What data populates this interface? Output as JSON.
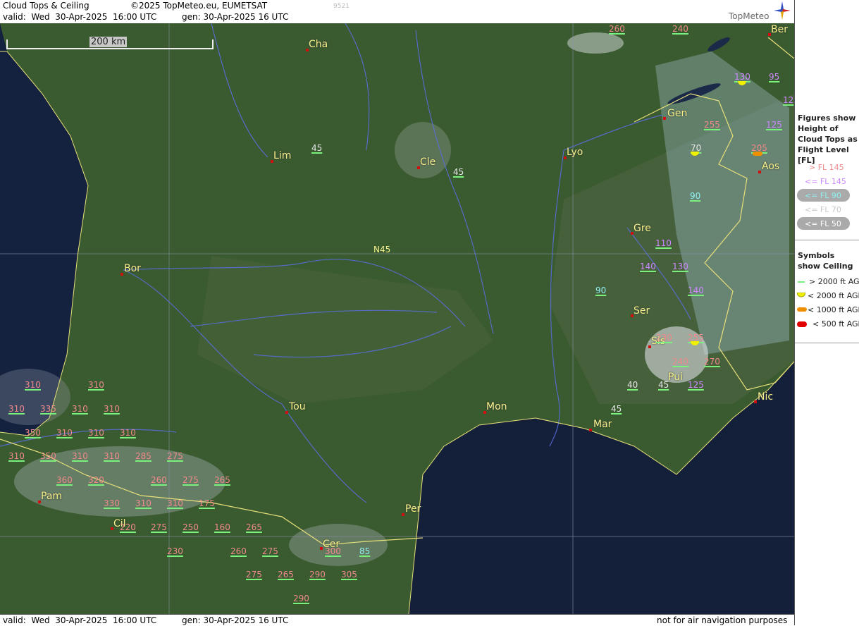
{
  "header": {
    "title": "Cloud Tops & Ceiling",
    "copyright": "©2025 TopMeteo.eu, EUMETSAT",
    "valid": "valid:  Wed  30-Apr-2025  16:00 UTC",
    "gen": "gen: 30-Apr-2025 16 UTC",
    "code": "9521",
    "logo": "TopMeteo"
  },
  "footer": {
    "valid": "valid:  Wed  30-Apr-2025  16:00 UTC",
    "gen": "gen: 30-Apr-2025 16 UTC",
    "disclaimer": "not for air navigation purposes"
  },
  "scale_label": "200 km",
  "graticule_label": "N45",
  "legend": {
    "figures_title": "Figures show Height of Cloud Tops as Flight Level  [FL]",
    "fl_items": [
      "> FL 145",
      "<= FL 145",
      "<= FL 90",
      "<= FL 70",
      "<= FL 50"
    ],
    "fl_colors": [
      "#f08a8a",
      "#cc88ff",
      "#8ff0f0",
      "#c8c8c8",
      "#e8e8e8"
    ],
    "symbols_title": "Symbols show Ceiling",
    "ceil_items": [
      "> 2000 ft AGL",
      "< 2000 ft AGL",
      "< 1000 ft AGL",
      "< 500 ft AGL"
    ],
    "ceil_colors": [
      "#7cf07c",
      "#f0f000",
      "#f09000",
      "#e00000"
    ]
  },
  "cities": [
    "Cha",
    "Lim",
    "Cle",
    "Lyo",
    "Gen",
    "Ber",
    "Aos",
    "Gre",
    "Bor",
    "Ser",
    "Sis",
    "Pui",
    "Nic",
    "Tou",
    "Mon",
    "Mar",
    "Pam",
    "Cil",
    "Per",
    "Cer"
  ],
  "cloud_tops": [
    "260",
    "240",
    "130",
    "95",
    "12",
    "255",
    "125",
    "70",
    "205",
    "45",
    "45",
    "90",
    "110",
    "140",
    "130",
    "90",
    "140",
    "230",
    "255",
    "240",
    "270",
    "40",
    "45",
    "125",
    "45",
    "310",
    "310",
    "310",
    "335",
    "310",
    "310",
    "350",
    "310",
    "310",
    "310",
    "310",
    "350",
    "310",
    "310",
    "285",
    "275",
    "360",
    "320",
    "260",
    "275",
    "265",
    "330",
    "310",
    "310",
    "175",
    "220",
    "275",
    "250",
    "160",
    "265",
    "230",
    "260",
    "275",
    "300",
    "85",
    "275",
    "265",
    "290",
    "305",
    "290"
  ]
}
